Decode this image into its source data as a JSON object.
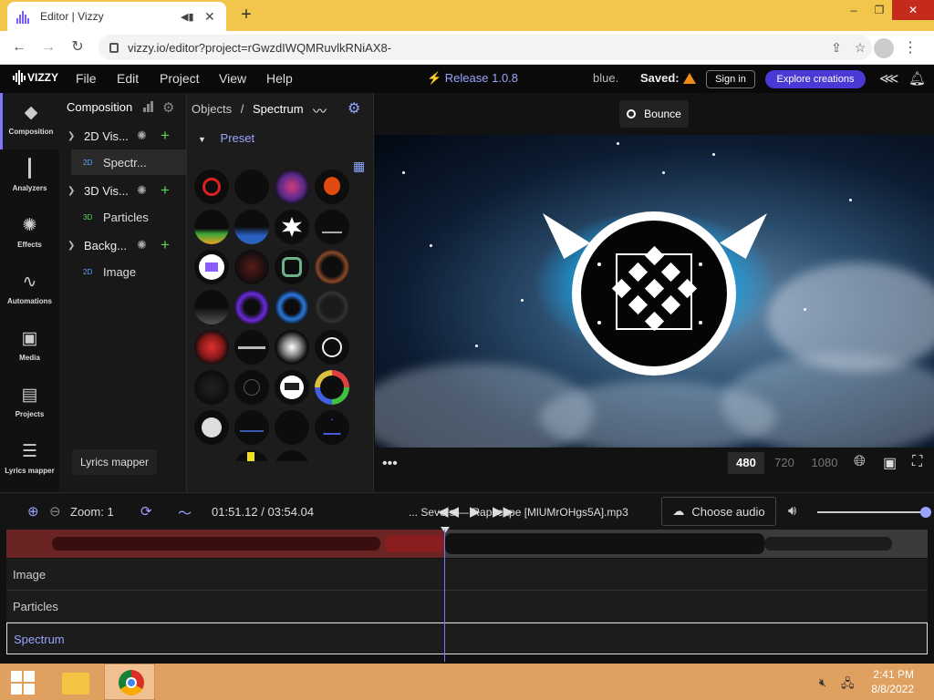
{
  "browser": {
    "tab_title": "Editor | Vizzy",
    "url": "vizzy.io/editor?project=rGwzdIWQMRuvlkRNiAX8-",
    "window_controls": [
      "–",
      "❐",
      "✕"
    ]
  },
  "app": {
    "logo": "VIZZY",
    "menu": [
      "File",
      "Edit",
      "Project",
      "View",
      "Help"
    ],
    "release": "⚡ Release 1.0.8",
    "project_name": "blue.",
    "saved_label": "Saved:",
    "sign_in": "Sign in",
    "explore": "Explore creations",
    "accent": "#4b39d6"
  },
  "rail": [
    {
      "label": "Composition",
      "icon": "layers-icon",
      "glyph": "◆",
      "active": true
    },
    {
      "label": "Analyzers",
      "icon": "waveform-icon",
      "glyph": "┃",
      "active": false
    },
    {
      "label": "Effects",
      "icon": "sparkle-icon",
      "glyph": "✺",
      "active": false
    },
    {
      "label": "Automations",
      "icon": "graph-icon",
      "glyph": "∿",
      "active": false
    },
    {
      "label": "Media",
      "icon": "gallery-icon",
      "glyph": "▣",
      "active": false
    },
    {
      "label": "Projects",
      "icon": "document-icon",
      "glyph": "▤",
      "active": false
    },
    {
      "label": "Lyrics mapper",
      "icon": "lyrics-icon",
      "glyph": "☰",
      "active": false
    }
  ],
  "tooltip": "Lyrics mapper",
  "composition": {
    "title": "Composition",
    "groups": [
      {
        "name": "2D Vis...",
        "items": [
          {
            "badge": "2D",
            "name": "Spectr...",
            "selected": true
          }
        ]
      },
      {
        "name": "3D Vis...",
        "items": [
          {
            "badge": "3D",
            "name": "Particles",
            "selected": false
          }
        ]
      },
      {
        "name": "Backg...",
        "items": [
          {
            "badge": "2D",
            "name": "Image",
            "selected": false
          }
        ]
      }
    ]
  },
  "objects": {
    "crumb_root": "Objects",
    "crumb_sep": "/",
    "crumb_current": "Spectrum",
    "preset_label": "Preset"
  },
  "preview": {
    "bounce_label": "Bounce",
    "resolutions": [
      "480",
      "720",
      "1080"
    ],
    "active_resolution": "480"
  },
  "timeline": {
    "zoom_label": "Zoom: 1",
    "time": "01:51.12 / 03:54.04",
    "file_name": "... Severs — Rapscape [MlUMrOHgs5A].mp3",
    "choose_audio": "Choose audio",
    "tracks": [
      "Image",
      "Particles",
      "Spectrum"
    ],
    "selected_track": "Spectrum",
    "played_fraction": 0.48,
    "volume_fraction": 1.0
  },
  "taskbar": {
    "time": "2:41 PM",
    "date": "8/8/2022"
  }
}
